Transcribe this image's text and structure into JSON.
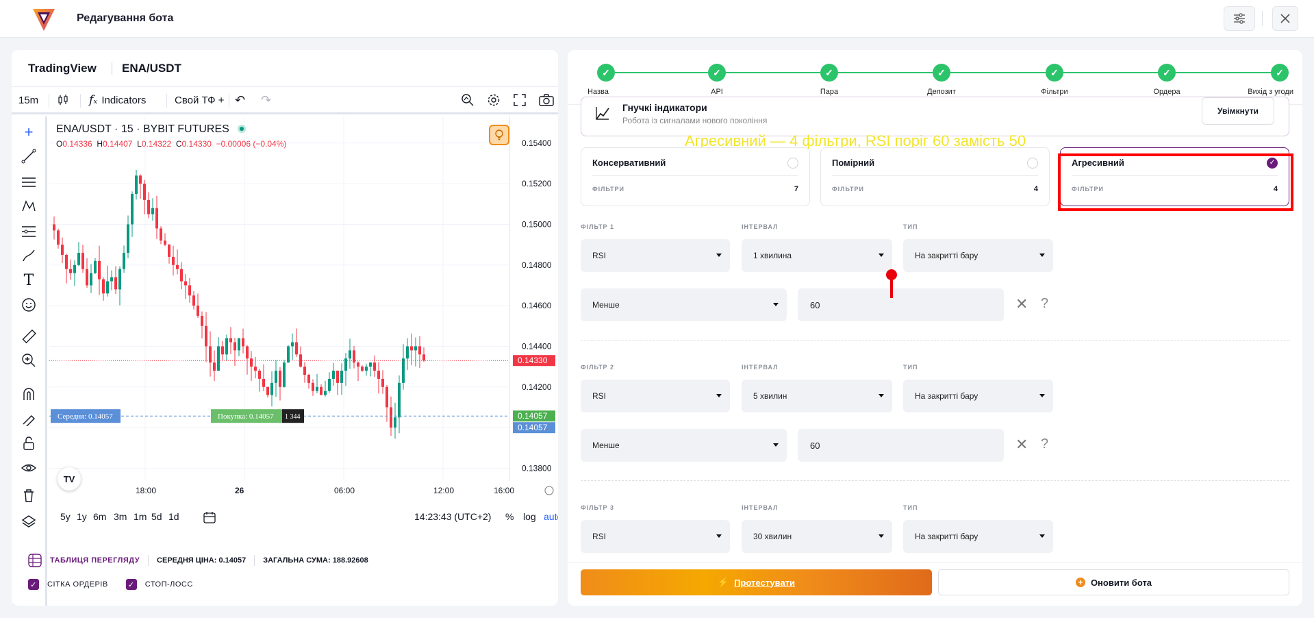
{
  "header": {
    "title": "Редагування бота"
  },
  "tv": {
    "brand": "TradingView",
    "pair": "ENA/USDT",
    "interval": "15m",
    "indicators": "Indicators",
    "custom_tf": "Свой ТФ +",
    "legend": "ENA/USDT · 15 · BYBIT FUTURES",
    "ohlc": {
      "o": "0.14336",
      "h": "0.14407",
      "l": "0.14322",
      "c": "0.14330",
      "chg": "−0.00006 (−0.04%)"
    },
    "price_labels": [
      "0.15400",
      "0.15200",
      "0.15000",
      "0.14800",
      "0.14600",
      "0.14400",
      "0.14200",
      "0.13800"
    ],
    "last_price": "0.14330",
    "avg_price_tag": "0.14057",
    "avg_price_tag2": "0.14057",
    "time_labels": [
      "18:00",
      "26",
      "06:00",
      "12:00",
      "16:00"
    ],
    "avg_line_label": "Середня: 0.14057",
    "buy_line_label": "Покупка: 0.14057",
    "buy_line_qty": "1 344",
    "ranges": [
      "5y",
      "1y",
      "6m",
      "3m",
      "1m",
      "5d",
      "1d"
    ],
    "clock": "14:23:43 (UTC+2)",
    "pct": "%",
    "log": "log",
    "auto": "auto"
  },
  "stats": {
    "table_label": "ТАБЛИЦЯ ПЕРЕГЛЯДУ",
    "avg_label": "СЕРЕДНЯ ЦІНА:",
    "avg_value": "0.14057",
    "sum_label": "ЗАГАЛЬНА СУМА:",
    "sum_value": "188.92608",
    "grid_label": "СІТКА ОРДЕРІВ",
    "stop_label": "СТОП-ЛОСС"
  },
  "steps": [
    "Назва",
    "API",
    "Пара",
    "Депозит",
    "Фільтри",
    "Ордера",
    "Вихід з угоди"
  ],
  "flex": {
    "title": "Гнучкі індикатори",
    "subtitle": "Робота із сигналами нового покоління",
    "button": "Увімкнути"
  },
  "annotation": "Агресивний — 4 фільтри, RSI поріг 60 замість 50",
  "presets": [
    {
      "name": "Консервативний",
      "filters_label": "ФІЛЬТРИ",
      "count": "7",
      "selected": false
    },
    {
      "name": "Помірний",
      "filters_label": "ФІЛЬТРИ",
      "count": "4",
      "selected": false
    },
    {
      "name": "Агресивний",
      "filters_label": "ФІЛЬТРИ",
      "count": "4",
      "selected": true
    }
  ],
  "filters": [
    {
      "label": "ФІЛЬТР 1",
      "interval_label": "ІНТЕРВАЛ",
      "type_label": "ТИП",
      "indicator": "RSI",
      "interval": "1 хвилина",
      "type": "На закритті бару",
      "cond": "Менше",
      "value": "60"
    },
    {
      "label": "ФІЛЬТР 2",
      "interval_label": "ІНТЕРВАЛ",
      "type_label": "ТИП",
      "indicator": "RSI",
      "interval": "5 хвилин",
      "type": "На закритті бару",
      "cond": "Менше",
      "value": "60"
    },
    {
      "label": "ФІЛЬТР 3",
      "interval_label": "ІНТЕРВАЛ",
      "type_label": "ТИП",
      "indicator": "RSI",
      "interval": "30 хвилин",
      "type": "На закритті бару"
    }
  ],
  "actions": {
    "test": "Протестувати",
    "update": "Оновити бота"
  },
  "colors": {
    "accent": "#6a1b7a",
    "up": "#089981",
    "down": "#f23645",
    "success": "#2cc46a",
    "orange": "#f08c1a",
    "highlight": "#ff0000"
  }
}
